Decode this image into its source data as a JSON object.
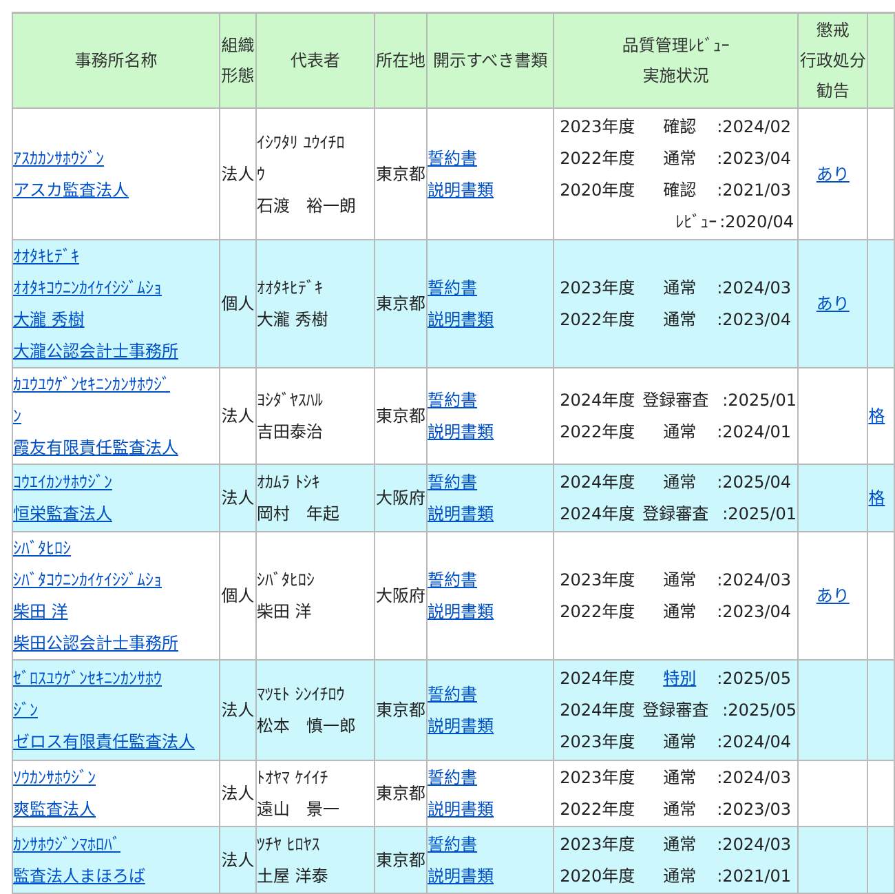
{
  "headers": {
    "name": "事務所名称",
    "org_lines": [
      "組織",
      "形態"
    ],
    "rep": "代表者",
    "loc": "所在地",
    "docs": "開示すべき書類",
    "review_lines": [
      "品質管理ﾚﾋﾞｭｰ",
      "実施状況"
    ],
    "disc_lines": [
      "懲戒",
      "行政処分",
      "勧告"
    ]
  },
  "rows": [
    {
      "office": [
        "ｱｽｶｶﾝｻﾎｳｼﾞﾝ",
        "アスカ監査法人"
      ],
      "org": "法人",
      "rep": [
        "ｲｼﾜﾀﾘ ﾕｳｲﾁﾛ",
        "ｳ",
        "石渡　裕一朗"
      ],
      "loc": "東京都",
      "docs": [
        "誓約書",
        "説明書類"
      ],
      "reviews": [
        {
          "year": "2023年度",
          "kind": "確認",
          "date": ":2024/02"
        },
        {
          "year": "2022年度",
          "kind": "通常",
          "date": ":2023/04"
        },
        {
          "year": "2020年度",
          "kind": "確認",
          "date": ":2021/03"
        },
        {
          "year": "",
          "kind": "ﾚﾋﾞｭｰ",
          "date": ":2020/04"
        }
      ],
      "disc": "あり",
      "edge": ""
    },
    {
      "office": [
        "ｵｵﾀｷﾋﾃﾞｷ",
        "ｵｵﾀｷｺｳﾆﾝｶｲｹｲｼｼﾞﾑｼｮ",
        "大瀧 秀樹",
        "大瀧公認会計士事務所"
      ],
      "org": "個人",
      "rep": [
        "ｵｵﾀｷﾋﾃﾞｷ",
        "大瀧 秀樹"
      ],
      "loc": "東京都",
      "docs": [
        "誓約書",
        "説明書類"
      ],
      "reviews": [
        {
          "year": "2023年度",
          "kind": "通常",
          "date": ":2024/03"
        },
        {
          "year": "2022年度",
          "kind": "通常",
          "date": ":2023/04"
        }
      ],
      "disc": "あり",
      "edge": ""
    },
    {
      "office": [
        "ｶﾕｳﾕｳｹﾞﾝｾｷﾆﾝｶﾝｻﾎｳｼﾞ",
        "ﾝ",
        "霞友有限責任監査法人"
      ],
      "org": "法人",
      "rep": [
        "ﾖｼﾀﾞﾔｽﾊﾙ",
        "吉田泰治"
      ],
      "loc": "東京都",
      "docs": [
        "誓約書",
        "説明書類"
      ],
      "reviews": [
        {
          "year": "2024年度",
          "kind": "登録審査",
          "date": ":2025/01"
        },
        {
          "year": "2022年度",
          "kind": "通常",
          "date": ":2024/01"
        }
      ],
      "disc": "",
      "edge": "格"
    },
    {
      "office": [
        "ｺｳｴｲｶﾝｻﾎｳｼﾞﾝ",
        "恒栄監査法人"
      ],
      "org": "法人",
      "rep": [
        "ｵｶﾑﾗ ﾄｼｷ",
        "岡村　年起"
      ],
      "loc": "大阪府",
      "docs": [
        "誓約書",
        "説明書類"
      ],
      "reviews": [
        {
          "year": "2024年度",
          "kind": "通常",
          "date": ":2025/04"
        },
        {
          "year": "2024年度",
          "kind": "登録審査",
          "date": ":2025/01"
        }
      ],
      "disc": "",
      "edge": "格"
    },
    {
      "office": [
        "ｼﾊﾞﾀﾋﾛｼ",
        "ｼﾊﾞﾀｺｳﾆﾝｶｲｹｲｼｼﾞﾑｼｮ",
        "柴田 洋",
        "柴田公認会計士事務所"
      ],
      "org": "個人",
      "rep": [
        "ｼﾊﾞﾀﾋﾛｼ",
        "柴田 洋"
      ],
      "loc": "大阪府",
      "docs": [
        "誓約書",
        "説明書類"
      ],
      "reviews": [
        {
          "year": "2023年度",
          "kind": "通常",
          "date": ":2024/03"
        },
        {
          "year": "2022年度",
          "kind": "通常",
          "date": ":2023/04"
        }
      ],
      "disc": "あり",
      "edge": ""
    },
    {
      "office": [
        "ｾﾞﾛｽﾕｳｹﾞﾝｾｷﾆﾝｶﾝｻﾎｳ",
        "ｼﾞﾝ",
        "ゼロス有限責任監査法人"
      ],
      "org": "法人",
      "rep": [
        "ﾏﾂﾓﾄ ｼﾝｲﾁﾛｳ",
        "松本　慎一郎"
      ],
      "loc": "東京都",
      "docs": [
        "誓約書",
        "説明書類"
      ],
      "reviews": [
        {
          "year": "2024年度",
          "kind": "特別",
          "date": ":2025/05",
          "link": true
        },
        {
          "year": "2024年度",
          "kind": "登録審査",
          "date": ":2025/05"
        },
        {
          "year": "2023年度",
          "kind": "通常",
          "date": ":2024/04"
        }
      ],
      "disc": "",
      "edge": ""
    },
    {
      "office": [
        "ｿｳｶﾝｻﾎｳｼﾞﾝ",
        "爽監査法人"
      ],
      "org": "法人",
      "rep": [
        "ﾄｵﾔﾏ ｹｲｲﾁ",
        "遠山　景一"
      ],
      "loc": "東京都",
      "docs": [
        "誓約書",
        "説明書類"
      ],
      "reviews": [
        {
          "year": "2023年度",
          "kind": "通常",
          "date": ":2024/03"
        },
        {
          "year": "2022年度",
          "kind": "通常",
          "date": ":2023/03"
        }
      ],
      "disc": "",
      "edge": ""
    },
    {
      "office": [
        "ｶﾝｻﾎｳｼﾞﾝﾏﾎﾛﾊﾞ",
        "監査法人まほろば"
      ],
      "org": "法人",
      "rep": [
        "ﾂﾁﾔ ﾋﾛﾔｽ",
        "土屋 洋泰"
      ],
      "loc": "東京都",
      "docs": [
        "誓約書",
        "説明書類"
      ],
      "reviews": [
        {
          "year": "2023年度",
          "kind": "通常",
          "date": ":2024/03"
        },
        {
          "year": "2020年度",
          "kind": "通常",
          "date": ":2021/01"
        }
      ],
      "disc": "",
      "edge": ""
    }
  ]
}
